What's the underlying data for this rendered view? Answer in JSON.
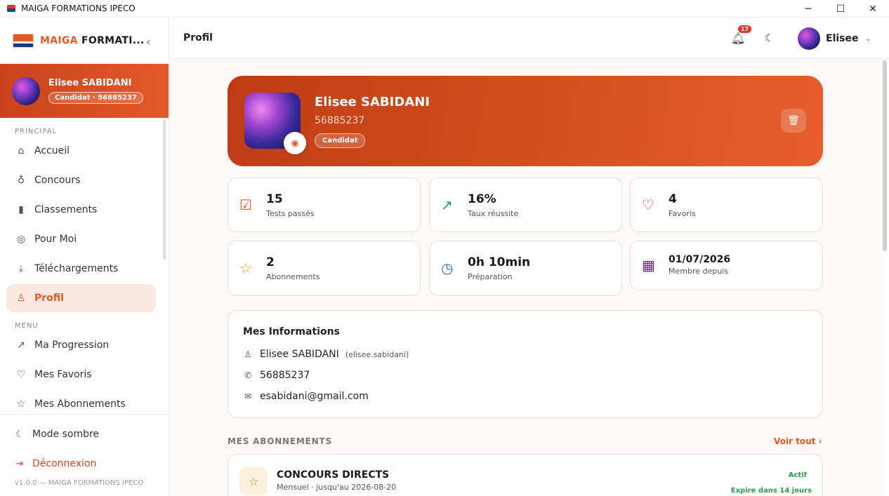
{
  "window": {
    "title": "MAIGA FORMATIONS IPECO",
    "controls": [
      "─",
      "☐",
      "✕"
    ]
  },
  "brand": {
    "part1": "MAIGA",
    "part2": "FORMATI..."
  },
  "user": {
    "name": "Elisee SABIDANI",
    "badge": "Candidat · 56885237"
  },
  "sidebar": {
    "section_principal": "PRINCIPAL",
    "principal_items": [
      {
        "label": "Accueil",
        "icon": "home-icon"
      },
      {
        "label": "Concours",
        "icon": "award-icon"
      },
      {
        "label": "Classements",
        "icon": "bar-chart-icon"
      },
      {
        "label": "Pour Moi",
        "icon": "target-icon"
      },
      {
        "label": "Téléchargements",
        "icon": "download-icon"
      },
      {
        "label": "Profil",
        "icon": "user-icon",
        "active": true
      }
    ],
    "section_menu": "MENU",
    "menu_items": [
      {
        "label": "Ma Progression",
        "icon": "trending-up-icon"
      },
      {
        "label": "Mes Favoris",
        "icon": "heart-icon"
      },
      {
        "label": "Mes Abonnements",
        "icon": "star-icon"
      }
    ],
    "dark_mode": "Mode sombre",
    "logout": "Déconnexion",
    "version": "v1.0.0 — MAIGA FORMATIONS IPECO"
  },
  "header": {
    "title": "Profil",
    "notifications": "17",
    "username": "Elisee"
  },
  "hero": {
    "name": "Elisee SABIDANI",
    "phone": "56885237",
    "role": "Candidat"
  },
  "stats": [
    {
      "value": "15",
      "label": "Tests passés",
      "icon": "check-square-icon",
      "color": "#e55a24"
    },
    {
      "value": "16%",
      "label": "Taux réussite",
      "icon": "trending-up-icon",
      "color": "#2a9d4b"
    },
    {
      "value": "4",
      "label": "Favoris",
      "icon": "heart-icon",
      "color": "#e03a3a"
    },
    {
      "value": "2",
      "label": "Abonnements",
      "icon": "star-icon",
      "color": "#e0a21a"
    },
    {
      "value": "0h 10min",
      "label": "Préparation",
      "icon": "clock-icon",
      "color": "#2a6fc0"
    },
    {
      "value": "01/07/2026",
      "label": "Membre depuis",
      "icon": "calendar-icon",
      "color": "#6a2a8a"
    }
  ],
  "info": {
    "title": "Mes Informations",
    "full_name": "Elisee SABIDANI",
    "username": "(elisee.sabidani)",
    "phone": "56885237",
    "email": "esabidani@gmail.com"
  },
  "subscriptions": {
    "heading": "MES ABONNEMENTS",
    "see_all": "Voir tout ›",
    "items": [
      {
        "name": "CONCOURS DIRECTS",
        "desc": "Mensuel · jusqu'au 2026-08-20",
        "status": "Actif",
        "expires": "Expire dans 14 jours"
      }
    ]
  }
}
